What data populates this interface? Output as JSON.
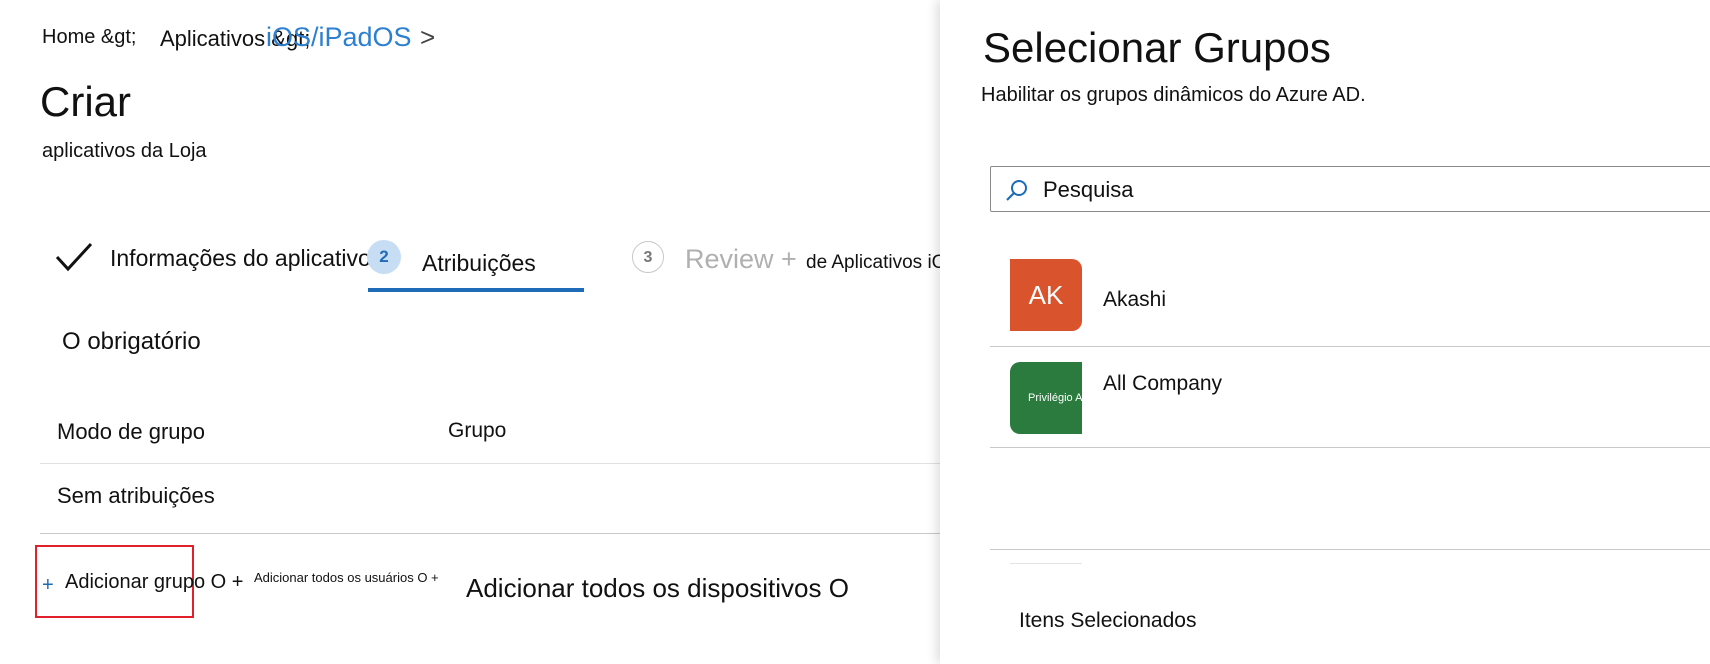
{
  "breadcrumb": {
    "home": "Home &gt;",
    "apps": "Aplicativos &gt;",
    "platform": "iOS/iPadOS",
    "chevron": ">"
  },
  "page": {
    "title": "Criar",
    "subtitle": "aplicativos da Loja"
  },
  "wizard": {
    "step1": {
      "label": "Informações do aplicativo",
      "state": "completed"
    },
    "step2": {
      "number": "2",
      "label": "Atribuições",
      "state": "active"
    },
    "step3": {
      "number": "3",
      "label": "Review +",
      "extra": "de Aplicativos iOS",
      "state": "pending"
    }
  },
  "assignments": {
    "heading": "O obrigatório",
    "columns": {
      "mode": "Modo de grupo",
      "group": "Grupo"
    },
    "empty_text": "Sem atribuições",
    "actions": {
      "plus": "+",
      "add_group": "Adicionar grupo O +",
      "add_all_users": "Adicionar todos os usuários O +",
      "add_all_devices": "Adicionar todos os dispositivos O"
    }
  },
  "panel": {
    "title": "Selecionar Grupos",
    "description": "Habilitar os grupos dinâmicos do Azure AD.",
    "search": {
      "placeholder": "Pesquisa",
      "value": ""
    },
    "groups": [
      {
        "initials": "AK",
        "name": "Akashi",
        "color": "#d9532c"
      },
      {
        "initials": "Privilégio A",
        "name": "All Company",
        "color": "#2b7a3e"
      }
    ],
    "selected_label": "Itens Selecionados"
  },
  "colors": {
    "accent": "#1e6bb8",
    "link": "#2d7fd2",
    "highlight_box": "#e0202a"
  }
}
